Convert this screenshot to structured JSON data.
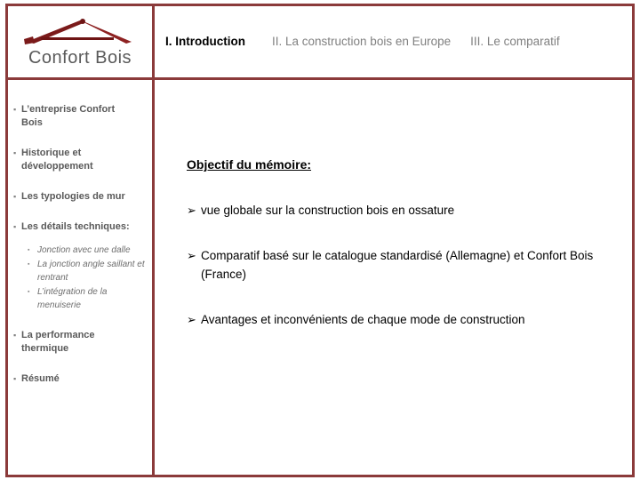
{
  "brand": {
    "logo_icon": "roof-compass-icon",
    "name": "Confort Bois",
    "accent_color": "#8B3A3A"
  },
  "nav": {
    "tabs": [
      {
        "label": "I. Introduction",
        "active": true
      },
      {
        "label": "II. La construction bois en Europe",
        "active": false
      },
      {
        "label": "III. Le comparatif",
        "active": false
      }
    ]
  },
  "sidebar": {
    "items": [
      {
        "label": "L’entreprise Confort Bois"
      },
      {
        "label": "Historique et développement"
      },
      {
        "label": "Les typologies de mur"
      },
      {
        "label": "Les détails techniques:",
        "subitems": [
          {
            "label": "Jonction avec une dalle"
          },
          {
            "label": "La jonction angle saillant et rentrant"
          },
          {
            "label": "L’intégration de la menuiserie"
          }
        ]
      },
      {
        "label": "La performance thermique"
      },
      {
        "label": "Résumé"
      }
    ]
  },
  "main": {
    "heading": "Objectif du mémoire:",
    "bullets": [
      {
        "text": "vue globale sur la construction bois en ossature"
      },
      {
        "text": "Comparatif basé sur le catalogue standardisé (Allemagne) et Confort Bois (France)"
      },
      {
        "text": "Avantages et inconvénients de chaque mode de construction"
      }
    ]
  }
}
